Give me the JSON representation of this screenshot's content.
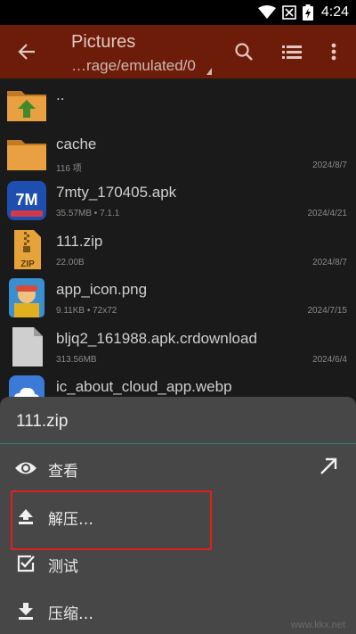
{
  "status_bar": {
    "time": "4:24"
  },
  "app_bar": {
    "title": "Pictures",
    "path": "…rage/emulated/0"
  },
  "files": [
    {
      "name": "..",
      "meta": "",
      "date": "",
      "icon": "folder-up-icon"
    },
    {
      "name": "cache",
      "meta": "116 项",
      "date": "2024/8/7",
      "icon": "folder-icon"
    },
    {
      "name": "7mty_170405.apk",
      "meta": "35.57MB  • 7.1.1",
      "date": "2024/4/21",
      "icon": "apk-app-icon"
    },
    {
      "name": "111.zip",
      "meta": "22.00B",
      "date": "2024/8/7",
      "icon": "zip-file-icon"
    },
    {
      "name": "app_icon.png",
      "meta": "9.11KB  • 72x72",
      "date": "2024/7/15",
      "icon": "image-thumbnail-icon"
    },
    {
      "name": "bljq2_161988.apk.crdownload",
      "meta": "313.56MB",
      "date": "2024/6/4",
      "icon": "document-file-icon"
    },
    {
      "name": "ic_about_cloud_app.webp",
      "meta": "",
      "date": "",
      "icon": "cloud-image-icon"
    }
  ],
  "sheet": {
    "title": "111.zip",
    "items": [
      {
        "label": "查看",
        "icon": "eye-icon"
      },
      {
        "label": "解压…",
        "icon": "upload-icon"
      },
      {
        "label": "测试",
        "icon": "checkbox-icon"
      },
      {
        "label": "压缩…",
        "icon": "download-icon"
      }
    ]
  },
  "watermark": "www.kkx.net",
  "colors": {
    "app_bar": "#6e1c0a",
    "sheet": "#474747",
    "accent_divider": "#2f7d78",
    "highlight": "#e0201a",
    "folder": "#e8a040"
  }
}
